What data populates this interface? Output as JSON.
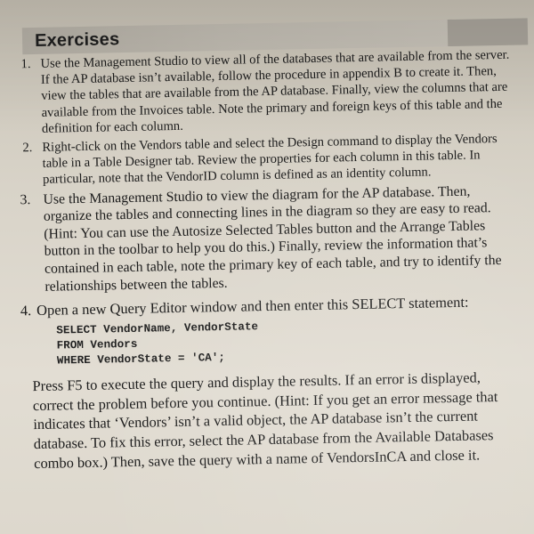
{
  "document": {
    "heading": "Exercises",
    "exercises": [
      {
        "number": "1.",
        "text": "Use the Management Studio to view all of the databases that are available from the server. If the AP database isn’t available, follow the procedure in appendix B to create it. Then, view the tables that are available from the AP database. Finally, view the columns that are available from the Invoices table. Note the primary and foreign keys of this table and the definition for each column."
      },
      {
        "number": "2.",
        "text": "Right-click on the Vendors table and select the Design command to display the Vendors table in a Table Designer tab. Review the properties for each column in this table. In particular, note that the VendorID column is defined as an identity column."
      },
      {
        "number": "3.",
        "text": "Use the Management Studio to view the diagram for the AP database. Then, organize the tables and connecting lines in the diagram so they are easy to read. (Hint: You can use the Autosize Selected Tables button and the Arrange Tables button in the toolbar to help you do this.) Finally, review the information that’s contained in each table, note the primary key of each table, and try to identify the relationships between the tables."
      },
      {
        "number": "4.",
        "text": "Open a new Query Editor window and then enter this SELECT statement:",
        "code": [
          "SELECT VendorName, VendorState",
          "FROM Vendors",
          "WHERE VendorState = 'CA';"
        ],
        "followup": "Press F5 to execute the query and display the results. If an error is displayed, correct the problem before you continue. (Hint: If you get an error message that indicates that ‘Vendors’ isn’t a valid object, the AP database isn’t the current database. To fix this error, select the AP database from the Available Databases combo box.) Then, save the query with a name of VendorsInCA and close it."
      }
    ]
  }
}
